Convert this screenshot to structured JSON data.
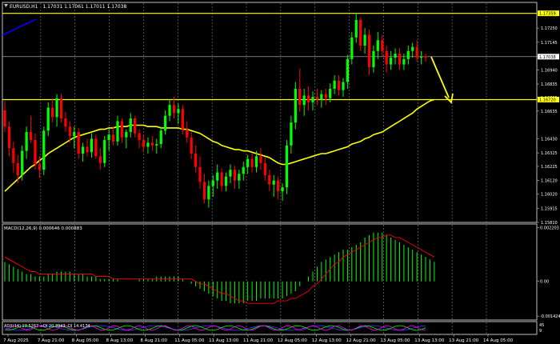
{
  "header": {
    "symbol_label": "EURUSD,H1",
    "ohlc": "1.17031 1.17061 1.17011 1.17038"
  },
  "price_axis": {
    "min": 1.1581,
    "max": 1.1744,
    "ticks": [
      "1.17250",
      "1.17145",
      "1.16940",
      "1.16835",
      "1.16735",
      "1.16635",
      "1.16430",
      "1.16325",
      "1.16225",
      "1.16120",
      "1.16020",
      "1.15915",
      "1.15810"
    ],
    "tick_values": [
      1.1725,
      1.17145,
      1.1694,
      1.16835,
      1.16735,
      1.16635,
      1.1643,
      1.16325,
      1.16225,
      1.1612,
      1.1602,
      1.15915,
      1.1581
    ],
    "current_price_label": "1.17038",
    "current_price": 1.17038,
    "levels": [
      {
        "label": "1.17359",
        "value": 1.17359,
        "color": "#ffff00"
      },
      {
        "label": "1.16720",
        "value": 1.1672,
        "color": "#ffff00"
      }
    ]
  },
  "time_axis": {
    "labels": [
      "7 Aug 2025",
      "7 Aug 21:00",
      "8 Aug 05:00",
      "8 Aug 13:00",
      "8 Aug 21:00",
      "11 Aug 05:00",
      "11 Aug 13:00",
      "11 Aug 21:00",
      "12 Aug 05:00",
      "12 Aug 13:00",
      "12 Aug 21:00",
      "13 Aug 05:00",
      "13 Aug 13:00",
      "13 Aug 21:00",
      "14 Aug 05:00"
    ]
  },
  "macd": {
    "label": "MACD(12,26,9) 0.000646 0.000883",
    "ticks": [
      "0.002203",
      "0.00",
      "-0.001424"
    ],
    "tick_values": [
      0.002203,
      0,
      -0.001424
    ],
    "min": -0.00155,
    "max": 0.00232
  },
  "adx": {
    "label": "ADX(14) 19.5267 +DI 20.3943 -DI 14.4174",
    "ticks": [
      "45",
      "9"
    ]
  },
  "colors": {
    "bull": "#00ff00",
    "bear": "#ff0000",
    "ma": "#ffff00",
    "grid": "#c0c0c0",
    "arrow": "#ffff00",
    "trend": "#0000ff",
    "macd_signal": "#ff0000"
  },
  "chart_data": {
    "type": "candlestick",
    "series": [
      {
        "name": "EURUSD,H1",
        "candles": [
          [
            1.1664,
            1.1671,
            1.1648,
            1.1652
          ],
          [
            1.1652,
            1.1656,
            1.163,
            1.1636
          ],
          [
            1.1636,
            1.1641,
            1.1618,
            1.1625
          ],
          [
            1.1625,
            1.1631,
            1.161,
            1.1616
          ],
          [
            1.1616,
            1.1638,
            1.1612,
            1.1634
          ],
          [
            1.1634,
            1.1652,
            1.1628,
            1.1648
          ],
          [
            1.1648,
            1.166,
            1.164,
            1.1642
          ],
          [
            1.1642,
            1.1647,
            1.162,
            1.1624
          ],
          [
            1.1624,
            1.163,
            1.1614,
            1.162
          ],
          [
            1.162,
            1.1652,
            1.1616,
            1.1649
          ],
          [
            1.1649,
            1.167,
            1.1645,
            1.1666
          ],
          [
            1.1666,
            1.1673,
            1.1655,
            1.1659
          ],
          [
            1.1659,
            1.1676,
            1.1652,
            1.1673
          ],
          [
            1.1673,
            1.1676,
            1.1655,
            1.1658
          ],
          [
            1.1658,
            1.1663,
            1.1648,
            1.1652
          ],
          [
            1.1652,
            1.1656,
            1.164,
            1.1645
          ],
          [
            1.1645,
            1.1652,
            1.1636,
            1.1648
          ],
          [
            1.1648,
            1.1651,
            1.1628,
            1.1632
          ],
          [
            1.1632,
            1.164,
            1.1626,
            1.1637
          ],
          [
            1.1637,
            1.1643,
            1.163,
            1.1633
          ],
          [
            1.1633,
            1.1647,
            1.1629,
            1.1643
          ],
          [
            1.1643,
            1.1646,
            1.1628,
            1.163
          ],
          [
            1.163,
            1.1636,
            1.162,
            1.1625
          ],
          [
            1.1625,
            1.1645,
            1.1622,
            1.1642
          ],
          [
            1.1642,
            1.165,
            1.1634,
            1.1646
          ],
          [
            1.1646,
            1.1652,
            1.1638,
            1.1641
          ],
          [
            1.1641,
            1.166,
            1.1638,
            1.1656
          ],
          [
            1.1656,
            1.1658,
            1.164,
            1.1644
          ],
          [
            1.1644,
            1.165,
            1.1636,
            1.1648
          ],
          [
            1.1648,
            1.1662,
            1.1644,
            1.1658
          ],
          [
            1.1658,
            1.166,
            1.1644,
            1.1647
          ],
          [
            1.1647,
            1.165,
            1.1636,
            1.1642
          ],
          [
            1.1642,
            1.1646,
            1.1633,
            1.1637
          ],
          [
            1.1637,
            1.1644,
            1.1632,
            1.164
          ],
          [
            1.164,
            1.1645,
            1.1634,
            1.1638
          ],
          [
            1.1638,
            1.1643,
            1.1632,
            1.1639
          ],
          [
            1.1639,
            1.1652,
            1.1636,
            1.1649
          ],
          [
            1.1649,
            1.1664,
            1.1646,
            1.166
          ],
          [
            1.166,
            1.1672,
            1.1656,
            1.1668
          ],
          [
            1.1668,
            1.1674,
            1.1658,
            1.1662
          ],
          [
            1.1662,
            1.1669,
            1.1654,
            1.1665
          ],
          [
            1.1665,
            1.1668,
            1.1646,
            1.165
          ],
          [
            1.165,
            1.1656,
            1.164,
            1.1644
          ],
          [
            1.1644,
            1.1648,
            1.1628,
            1.1632
          ],
          [
            1.1632,
            1.1638,
            1.1618,
            1.1622
          ],
          [
            1.1622,
            1.163,
            1.1606,
            1.1611
          ],
          [
            1.1611,
            1.1617,
            1.1595,
            1.1598
          ],
          [
            1.1598,
            1.1612,
            1.1592,
            1.1608
          ],
          [
            1.1608,
            1.1616,
            1.16,
            1.1612
          ],
          [
            1.1612,
            1.1624,
            1.1606,
            1.1618
          ],
          [
            1.1618,
            1.1621,
            1.1604,
            1.1608
          ],
          [
            1.1608,
            1.1618,
            1.1604,
            1.1615
          ],
          [
            1.1615,
            1.1624,
            1.161,
            1.162
          ],
          [
            1.162,
            1.1623,
            1.1606,
            1.1612
          ],
          [
            1.1612,
            1.162,
            1.1606,
            1.1617
          ],
          [
            1.1617,
            1.1626,
            1.1612,
            1.1622
          ],
          [
            1.1622,
            1.1631,
            1.1617,
            1.1628
          ],
          [
            1.1628,
            1.1632,
            1.1618,
            1.1622
          ],
          [
            1.1622,
            1.1634,
            1.1618,
            1.163
          ],
          [
            1.163,
            1.1636,
            1.162,
            1.1625
          ],
          [
            1.1625,
            1.1629,
            1.1612,
            1.1616
          ],
          [
            1.1616,
            1.162,
            1.1604,
            1.1609
          ],
          [
            1.1609,
            1.1616,
            1.16,
            1.1612
          ],
          [
            1.1612,
            1.1615,
            1.1598,
            1.1604
          ],
          [
            1.1604,
            1.161,
            1.1597,
            1.1607
          ],
          [
            1.1607,
            1.1642,
            1.1602,
            1.1638
          ],
          [
            1.1638,
            1.166,
            1.1632,
            1.1655
          ],
          [
            1.1655,
            1.1685,
            1.165,
            1.168
          ],
          [
            1.168,
            1.1695,
            1.1663,
            1.1668
          ],
          [
            1.1668,
            1.168,
            1.166,
            1.1675
          ],
          [
            1.1675,
            1.1682,
            1.1664,
            1.167
          ],
          [
            1.167,
            1.1678,
            1.1664,
            1.1674
          ],
          [
            1.1674,
            1.168,
            1.1668,
            1.1672
          ],
          [
            1.1672,
            1.1679,
            1.1666,
            1.1676
          ],
          [
            1.1676,
            1.168,
            1.1668,
            1.1673
          ],
          [
            1.1673,
            1.1684,
            1.167,
            1.168
          ],
          [
            1.168,
            1.169,
            1.1676,
            1.1686
          ],
          [
            1.1686,
            1.169,
            1.1675,
            1.1679
          ],
          [
            1.1679,
            1.1688,
            1.1674,
            1.1685
          ],
          [
            1.1685,
            1.1705,
            1.168,
            1.1702
          ],
          [
            1.1702,
            1.1722,
            1.1698,
            1.1718
          ],
          [
            1.1718,
            1.1736,
            1.1714,
            1.1731
          ],
          [
            1.1731,
            1.1733,
            1.1708,
            1.1712
          ],
          [
            1.1712,
            1.1725,
            1.1706,
            1.172
          ],
          [
            1.172,
            1.1724,
            1.169,
            1.1696
          ],
          [
            1.1696,
            1.1712,
            1.1692,
            1.1708
          ],
          [
            1.1708,
            1.1722,
            1.1702,
            1.1716
          ],
          [
            1.1716,
            1.172,
            1.1704,
            1.1708
          ],
          [
            1.1708,
            1.1712,
            1.1692,
            1.1698
          ],
          [
            1.1698,
            1.1708,
            1.1694,
            1.1703
          ],
          [
            1.1703,
            1.171,
            1.1698,
            1.1706
          ],
          [
            1.1706,
            1.171,
            1.1694,
            1.1698
          ],
          [
            1.1698,
            1.1706,
            1.1694,
            1.1702
          ],
          [
            1.1702,
            1.1712,
            1.1698,
            1.1708
          ],
          [
            1.1708,
            1.1714,
            1.1703,
            1.1711
          ],
          [
            1.1711,
            1.1716,
            1.17,
            1.1703
          ],
          [
            1.1703,
            1.1708,
            1.1698,
            1.1704
          ],
          [
            1.1704,
            1.1706,
            1.17,
            1.1703
          ]
        ]
      }
    ],
    "ma": [
      1.1604,
      1.1607,
      1.161,
      1.1613,
      1.1616,
      1.1619,
      1.1622,
      1.1624,
      1.1627,
      1.1629,
      1.1632,
      1.1634,
      1.1636,
      1.1638,
      1.164,
      1.1642,
      1.1644,
      1.1645,
      1.1646,
      1.1647,
      1.1648,
      1.1649,
      1.165,
      1.165,
      1.1651,
      1.1651,
      1.1652,
      1.1652,
      1.1652,
      1.1653,
      1.1653,
      1.1653,
      1.1653,
      1.1652,
      1.1652,
      1.1652,
      1.1651,
      1.1651,
      1.1651,
      1.1651,
      1.1651,
      1.165,
      1.165,
      1.1649,
      1.1648,
      1.1647,
      1.1645,
      1.1643,
      1.1641,
      1.164,
      1.1638,
      1.1637,
      1.1636,
      1.1635,
      1.1635,
      1.1634,
      1.1634,
      1.1633,
      1.1632,
      1.1631,
      1.163,
      1.1629,
      1.1627,
      1.1625,
      1.1624,
      1.1624,
      1.1625,
      1.1626,
      1.1627,
      1.1628,
      1.1629,
      1.163,
      1.1631,
      1.1632,
      1.1632,
      1.1633,
      1.1634,
      1.1635,
      1.1636,
      1.1637,
      1.1639,
      1.164,
      1.1641,
      1.1643,
      1.1644,
      1.1646,
      1.1647,
      1.1648,
      1.165,
      1.1652,
      1.1654,
      1.1656,
      1.1658,
      1.166,
      1.1662,
      1.1665,
      1.1667,
      1.1669,
      1.1671,
      1.1672
    ],
    "macd_hist": [
      0.0008,
      0.0007,
      0.0006,
      0.0005,
      0.0004,
      0.0003,
      0.0003,
      0.0002,
      0.0002,
      0.0002,
      0.0003,
      0.0003,
      0.0004,
      0.0004,
      0.0004,
      0.0004,
      0.0003,
      0.0003,
      0.0003,
      0.0002,
      0.0002,
      0.0002,
      0.0001,
      0.0001,
      0.0001,
      0.0001,
      0.0001,
      0.0,
      0.0,
      -0.0,
      0.0,
      0.0001,
      0.0001,
      0.0001,
      0.0001,
      0.0002,
      0.0002,
      0.0002,
      0.0002,
      0.0002,
      0.0002,
      0.0001,
      0.0,
      -0.0001,
      -0.0002,
      -0.0003,
      -0.0004,
      -0.0005,
      -0.0006,
      -0.0007,
      -0.0008,
      -0.0008,
      -0.0009,
      -0.0009,
      -0.0009,
      -0.0009,
      -0.0008,
      -0.0008,
      -0.0008,
      -0.0007,
      -0.0007,
      -0.0007,
      -0.0007,
      -0.0007,
      -0.0007,
      -0.0006,
      -0.0005,
      -0.0004,
      -0.0002,
      0.0,
      0.0002,
      0.0004,
      0.0006,
      0.0008,
      0.0009,
      0.001,
      0.0011,
      0.0012,
      0.0013,
      0.0013,
      0.0014,
      0.0015,
      0.0016,
      0.0018,
      0.0019,
      0.002,
      0.002,
      0.002,
      0.0019,
      0.0018,
      0.0017,
      0.0016,
      0.0015,
      0.0014,
      0.0013,
      0.0012,
      0.0011,
      0.001,
      0.0009,
      0.0008
    ],
    "macd_signal": [
      0.001,
      0.0009,
      0.0008,
      0.0007,
      0.0006,
      0.0005,
      0.0004,
      0.0004,
      0.0003,
      0.0003,
      0.0003,
      0.0003,
      0.0003,
      0.0003,
      0.0003,
      0.0003,
      0.0003,
      0.0003,
      0.0003,
      0.0003,
      0.0003,
      0.0002,
      0.0002,
      0.0002,
      0.0002,
      0.0001,
      0.0001,
      0.0001,
      0.0001,
      0.0001,
      0.0001,
      0.0001,
      0.0001,
      0.0001,
      0.0001,
      0.0001,
      0.0001,
      0.0001,
      0.0001,
      0.0001,
      0.0001,
      0.0001,
      0.0001,
      0.0001,
      0.0,
      -0.0001,
      -0.0001,
      -0.0002,
      -0.0003,
      -0.0004,
      -0.0005,
      -0.0005,
      -0.0006,
      -0.0007,
      -0.0008,
      -0.0008,
      -0.0009,
      -0.0009,
      -0.0009,
      -0.0009,
      -0.0009,
      -0.0009,
      -0.0009,
      -0.0008,
      -0.0008,
      -0.0008,
      -0.0007,
      -0.0007,
      -0.0006,
      -0.0005,
      -0.0004,
      -0.0002,
      -0.0001,
      0.0001,
      0.0003,
      0.0005,
      0.0007,
      0.0008,
      0.001,
      0.0011,
      0.0012,
      0.0013,
      0.0014,
      0.0015,
      0.0016,
      0.0017,
      0.0018,
      0.0018,
      0.0019,
      0.0019,
      0.0018,
      0.0018,
      0.0017,
      0.0016,
      0.0015,
      0.0014,
      0.0013,
      0.0012,
      0.0011,
      0.001
    ]
  }
}
